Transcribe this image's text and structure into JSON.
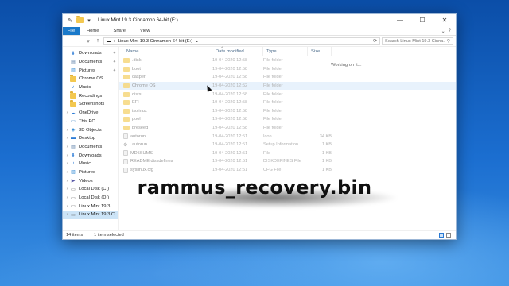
{
  "window": {
    "title": "Linux Mint 19.3 Cinnamon 64-bit (E:)",
    "controls": {
      "minimize": "—",
      "maximize": "☐",
      "close": "✕"
    }
  },
  "ribbon": {
    "tabs": [
      "File",
      "Home",
      "Share",
      "View"
    ],
    "right_icons": {
      "collapse": "⌄",
      "help": "?"
    }
  },
  "address_bar": {
    "path": [
      "Linux Mint 19.3 Cinnamon 64-bit (E:)"
    ],
    "search_placeholder": "Search Linux Mint 19.3 Cinna..."
  },
  "nav_pane": {
    "items": [
      {
        "label": "Downloads",
        "icon": "download-icon",
        "pinned": true
      },
      {
        "label": "Documents",
        "icon": "documents-icon",
        "pinned": true
      },
      {
        "label": "Pictures",
        "icon": "pictures-icon",
        "pinned": true
      },
      {
        "label": "Chrome OS",
        "icon": "folder-icon"
      },
      {
        "label": "Music",
        "icon": "music-icon"
      },
      {
        "label": "Recordings",
        "icon": "folder-icon"
      },
      {
        "label": "Screenshots",
        "icon": "folder-icon"
      },
      {
        "label": "OneDrive",
        "icon": "onedrive-icon"
      },
      {
        "label": "This PC",
        "icon": "pc-icon"
      },
      {
        "label": "3D Objects",
        "icon": "3d-objects-icon"
      },
      {
        "label": "Desktop",
        "icon": "desktop-icon"
      },
      {
        "label": "Documents",
        "icon": "documents-icon"
      },
      {
        "label": "Downloads",
        "icon": "download-icon"
      },
      {
        "label": "Music",
        "icon": "music-icon"
      },
      {
        "label": "Pictures",
        "icon": "pictures-icon"
      },
      {
        "label": "Videos",
        "icon": "videos-icon"
      },
      {
        "label": "Local Disk (C:)",
        "icon": "disk-icon"
      },
      {
        "label": "Local Disk (D:)",
        "icon": "disk-icon"
      },
      {
        "label": "Linux Mint 19.3",
        "icon": "usb-drive-icon"
      },
      {
        "label": "Linux Mint 19.3 C",
        "icon": "usb-drive-icon"
      }
    ]
  },
  "columns": {
    "name": "Name",
    "date": "Date modified",
    "type": "Type",
    "size": "Size"
  },
  "status_working": "Working on it...",
  "files": [
    {
      "name": ".disk",
      "date": "19-04-2020 12:58",
      "type": "File folder",
      "size": "",
      "kind": "folder"
    },
    {
      "name": "boot",
      "date": "19-04-2020 12:58",
      "type": "File folder",
      "size": "",
      "kind": "folder"
    },
    {
      "name": "casper",
      "date": "19-04-2020 12:58",
      "type": "File folder",
      "size": "",
      "kind": "folder"
    },
    {
      "name": "Chrome OS",
      "date": "19-04-2020 12:52",
      "type": "File folder",
      "size": "",
      "kind": "folder"
    },
    {
      "name": "dists",
      "date": "19-04-2020 12:58",
      "type": "File folder",
      "size": "",
      "kind": "folder"
    },
    {
      "name": "EFI",
      "date": "19-04-2020 12:58",
      "type": "File folder",
      "size": "",
      "kind": "folder"
    },
    {
      "name": "isolinux",
      "date": "19-04-2020 12:58",
      "type": "File folder",
      "size": "",
      "kind": "folder"
    },
    {
      "name": "pool",
      "date": "19-04-2020 12:58",
      "type": "File folder",
      "size": "",
      "kind": "folder"
    },
    {
      "name": "preseed",
      "date": "19-04-2020 12:58",
      "type": "File folder",
      "size": "",
      "kind": "folder"
    },
    {
      "name": "autorun",
      "date": "19-04-2020 12:51",
      "type": "Icon",
      "size": "34 KB",
      "kind": "file"
    },
    {
      "name": "autorun",
      "date": "19-04-2020 12:51",
      "type": "Setup Information",
      "size": "1 KB",
      "kind": "gear"
    },
    {
      "name": "MD5SUMS",
      "date": "19-04-2020 12:51",
      "type": "File",
      "size": "1 KB",
      "kind": "file"
    },
    {
      "name": "README.diskdefines",
      "date": "19-04-2020 12:51",
      "type": "DISKDEFINES File",
      "size": "1 KB",
      "kind": "file"
    },
    {
      "name": "syslinux.cfg",
      "date": "19-04-2020 12:51",
      "type": "CFG File",
      "size": "1 KB",
      "kind": "file"
    }
  ],
  "statusbar": {
    "items_count": "14 items",
    "selected": "1 item selected"
  },
  "overlay_text": "rammus_recovery.bin"
}
